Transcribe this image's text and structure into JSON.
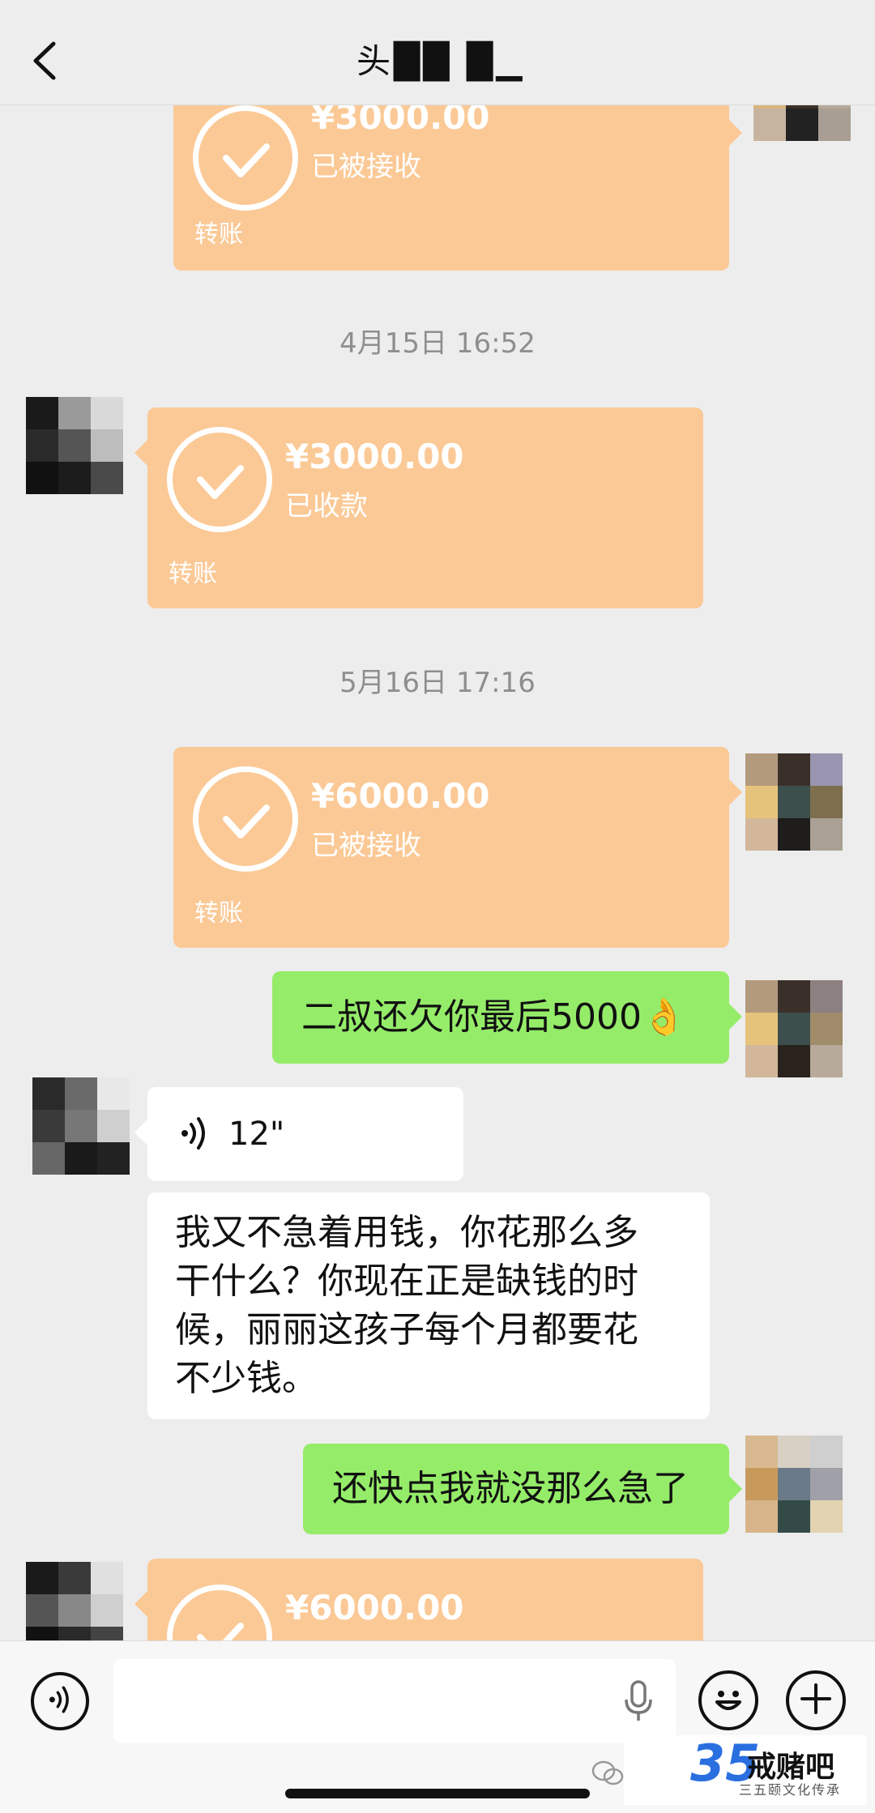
{
  "header": {
    "title": "头██ █▁",
    "back_icon": "chevron-left-icon"
  },
  "messages": [
    {
      "type": "transfer",
      "side": "right",
      "amount": "¥3000.00",
      "status": "已被接收",
      "kind": "转账"
    },
    {
      "type": "timestamp",
      "text": "4月15日 16:52"
    },
    {
      "type": "transfer",
      "side": "left",
      "amount": "¥3000.00",
      "status": "已收款",
      "kind": "转账"
    },
    {
      "type": "timestamp",
      "text": "5月16日 17:16"
    },
    {
      "type": "transfer",
      "side": "right",
      "amount": "¥6000.00",
      "status": "已被接收",
      "kind": "转账"
    },
    {
      "type": "text",
      "side": "right",
      "text": "二叔还欠你最后5000👌"
    },
    {
      "type": "voice",
      "side": "left",
      "duration": "12\""
    },
    {
      "type": "text",
      "side": "left",
      "lines": [
        "我又不急着用钱，你花那么多",
        "干什么？你现在正是缺钱的时",
        "候，丽丽这孩子每个月都要花",
        "不少钱。"
      ]
    },
    {
      "type": "text",
      "side": "right",
      "text": "还快点我就没那么急了"
    },
    {
      "type": "transfer",
      "side": "left",
      "amount": "¥6000.00",
      "status": "",
      "kind": ""
    }
  ],
  "bottom_bar": {
    "voice_icon": "voice-input-icon",
    "mic_icon": "microphone-icon",
    "emoji_icon": "emoji-icon",
    "plus_icon": "plus-icon"
  },
  "watermark": {
    "number": "35",
    "name": "戒赌吧",
    "subtitle": "三五颐文化传承"
  },
  "colors": {
    "background": "#ededed",
    "transfer": "#fbc996",
    "green_bubble": "#95ec69",
    "white_bubble": "#ffffff",
    "timestamp": "#8e8e8e"
  }
}
